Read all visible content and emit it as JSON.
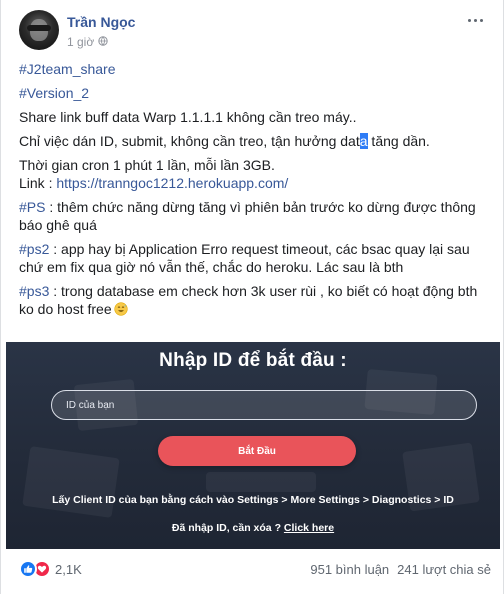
{
  "post": {
    "author": "Trần Ngọc",
    "time": "1 giờ",
    "lines": {
      "tag1": "#J2team_share",
      "tag2": "#Version_2",
      "line3": "Share link buff data Warp 1.1.1.1 không cần treo máy..",
      "line4_pre": "Chỉ việc dán ID,  submit,  không cần treo, tận hưởng dat",
      "line4_hl": "a",
      "line4_post": " tăng dần.",
      "line5": "Thời gian cron 1 phút 1 lần, mỗi lần 3GB.",
      "line6_label": "Link : ",
      "line6_url": "https://tranngoc1212.herokuapp.com/",
      "ps_tag": "#PS",
      "ps_text": " : thêm chức năng dừng tăng vì phiên bản trước ko dừng được thông báo ghê quá",
      "ps2_tag": "#ps2",
      "ps2_text": " : app hay bị Application Erro request timeout, các bsac quay lại sau chứ em fix qua giờ nó vẫn thế, chắc do heroku. Lác sau là bth",
      "ps3_tag": "#ps3",
      "ps3_text": " : trong database em check hơn 3k user rùi , ko biết có hoạt động bth ko do host free"
    },
    "emoji_icon": "sweat-smile-emoji"
  },
  "screenshot": {
    "title": "Nhập ID để bắt đầu :",
    "input_placeholder": "ID của bạn",
    "button_label": "Bắt Đầu",
    "hint": "Lấy Client ID của bạn bằng cách vào Settings > More Settings > Diagnostics > ID",
    "again_text": "Đã nhập ID, cần xóa ? ",
    "again_link": "Click here",
    "colors": {
      "background": "#232b3a",
      "button": "#e9545a"
    }
  },
  "footer": {
    "reaction_icons": [
      "like-icon",
      "love-icon"
    ],
    "reaction_count": "2,1K",
    "comments": "951 bình luận",
    "shares": "241 lượt chia sẻ"
  },
  "colors": {
    "link": "#385898",
    "highlight": "#2e7cf6"
  }
}
